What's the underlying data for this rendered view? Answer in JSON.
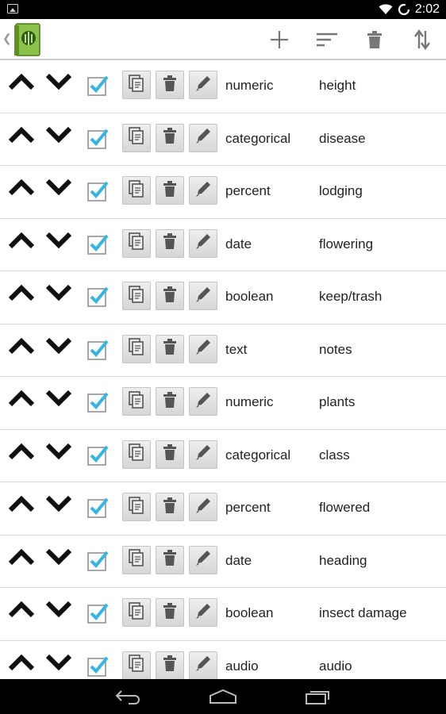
{
  "status_bar": {
    "time": "2:02",
    "icons": [
      "gallery-notification-icon",
      "wifi-icon",
      "sync-icon"
    ]
  },
  "action_bar": {
    "icons": [
      "app-logo-icon",
      "add-icon",
      "sort-icon",
      "delete-icon",
      "reorder-icon"
    ]
  },
  "colors": {
    "check_blue": "#33b5e5",
    "button_grey": "#dddddd",
    "divider": "#dcdcdc"
  },
  "rows": [
    {
      "type": "numeric",
      "name": "height"
    },
    {
      "type": "categorical",
      "name": "disease"
    },
    {
      "type": "percent",
      "name": "lodging"
    },
    {
      "type": "date",
      "name": "flowering"
    },
    {
      "type": "boolean",
      "name": "keep/trash"
    },
    {
      "type": "text",
      "name": "notes"
    },
    {
      "type": "numeric",
      "name": "plants"
    },
    {
      "type": "categorical",
      "name": "class"
    },
    {
      "type": "percent",
      "name": "flowered"
    },
    {
      "type": "date",
      "name": "heading"
    },
    {
      "type": "boolean",
      "name": "insect damage"
    },
    {
      "type": "audio",
      "name": "audio"
    }
  ],
  "nav_bar": {
    "icons": [
      "back-icon",
      "home-icon",
      "recents-icon"
    ]
  }
}
